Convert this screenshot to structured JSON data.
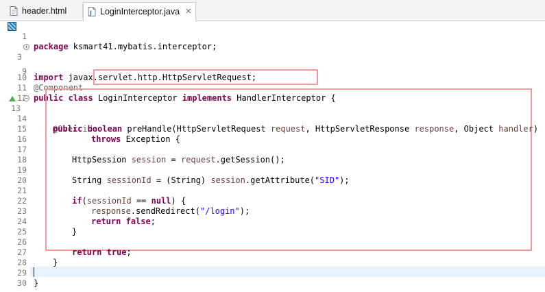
{
  "tabs": [
    {
      "label": "header.html",
      "active": false,
      "icon": "html-file-icon"
    },
    {
      "label": "LoginInterceptor.java",
      "active": true,
      "icon": "java-file-icon",
      "close": "✕"
    }
  ],
  "gutter": {
    "line_numbers": [
      "1",
      "3",
      "9",
      "10",
      "11",
      "12",
      "13",
      "14",
      "15",
      "16",
      "17",
      "18",
      "19",
      "20",
      "21",
      "22",
      "23",
      "24",
      "25",
      "26",
      "27",
      "28",
      "29",
      "30"
    ]
  },
  "code": {
    "l1": {
      "kw": "package",
      "rest": " ksmart41.mybatis.interceptor;"
    },
    "l3": {
      "kw": "import",
      "rest": " javax.servlet.http.HttpServletRequest;"
    },
    "l10": {
      "ann": "@Component"
    },
    "l11": {
      "kw1": "public class",
      "name": "LoginInterceptor",
      "kw2": "implements",
      "iface": "HandlerInterceptor",
      "brace": " {"
    },
    "l13": {
      "ann": "@Override"
    },
    "l14": {
      "kw": "public boolean",
      "p1": " preHandle(HttpServletRequest ",
      "v1": "request",
      "p2": ", HttpServletResponse ",
      "v2": "response",
      "p3": ", Object ",
      "v3": "handler",
      "p4": ")"
    },
    "l15": {
      "kw": "throws",
      "rest": " Exception {"
    },
    "l17": {
      "p1": "HttpSession ",
      "v1": "session",
      "p2": " = ",
      "v2": "request",
      "p3": ".getSession();"
    },
    "l19": {
      "p1": "String ",
      "v1": "sessionId",
      "p2": " = (String) ",
      "v2": "session",
      "p3": ".getAttribute(",
      "s": "\"SID\"",
      "p4": ");"
    },
    "l21": {
      "kw": "if",
      "p1": "(",
      "v1": "sessionId",
      "p2": " == ",
      "kw2": "null",
      "p3": ") {"
    },
    "l22": {
      "v1": "response",
      "p1": ".sendRedirect(",
      "s": "\"/login\"",
      "p2": ");"
    },
    "l23": {
      "kw": "return",
      "p1": " ",
      "kw2": "false",
      "p2": ";"
    },
    "l24": {
      "p1": "}"
    },
    "l26": {
      "kw": "return",
      "p1": " ",
      "kw2": "true",
      "p2": ";"
    },
    "l27": {
      "p1": "}"
    },
    "l29": {
      "p1": "}"
    }
  },
  "colors": {
    "keyword": "#7f0055",
    "annotation": "#646464",
    "variable": "#6a3e3e",
    "string": "#2a00ff",
    "highlight_box": "#f29a9a"
  }
}
